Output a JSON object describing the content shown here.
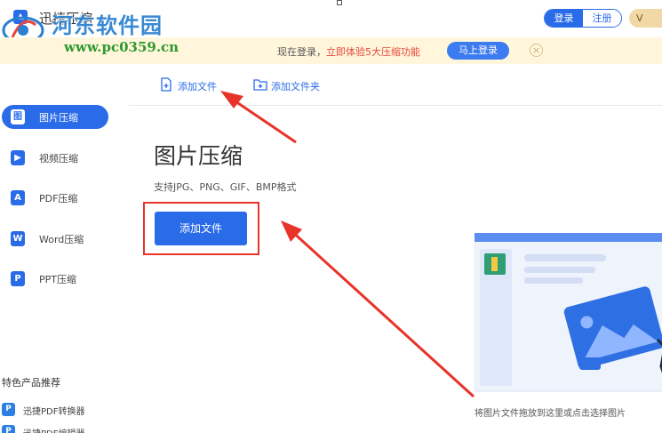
{
  "titlebar": {
    "app_title": "迅捷压缩",
    "watermark_name": "河东软件园",
    "watermark_url": "www.pc0359.cn",
    "login_label": "登录",
    "register_label": "注册",
    "vip_label": "V"
  },
  "notice": {
    "text_plain": "现在登录，",
    "text_highlight": "立即体验5大压缩功能",
    "button_label": "马上登录",
    "close_glyph": "×"
  },
  "sidebar": {
    "items": [
      {
        "label": "图片压缩",
        "icon": "image-icon",
        "glyph": "图",
        "active": true
      },
      {
        "label": "视频压缩",
        "icon": "video-icon",
        "glyph": "▶",
        "active": false
      },
      {
        "label": "PDF压缩",
        "icon": "pdf-icon",
        "glyph": "A",
        "active": false
      },
      {
        "label": "Word压缩",
        "icon": "word-icon",
        "glyph": "W",
        "active": false
      },
      {
        "label": "PPT压缩",
        "icon": "ppt-icon",
        "glyph": "P",
        "active": false
      }
    ],
    "recommend_title": "特色产品推荐",
    "recommend": [
      {
        "label": "迅捷PDF转换器",
        "glyph": "P"
      },
      {
        "label": "迅捷PDF编辑器",
        "glyph": "P"
      }
    ]
  },
  "toolbar": {
    "add_file_label": "添加文件",
    "add_folder_label": "添加文件夹"
  },
  "main": {
    "title": "图片压缩",
    "formats": "支持JPG、PNG、GIF、BMP格式",
    "add_file_button": "添加文件",
    "drop_hint": "将图片文件拖放到这里或点击选择图片"
  },
  "colors": {
    "accent": "#2a6be8",
    "annotation": "#e8332a",
    "notice_bg": "#fff6dc"
  }
}
